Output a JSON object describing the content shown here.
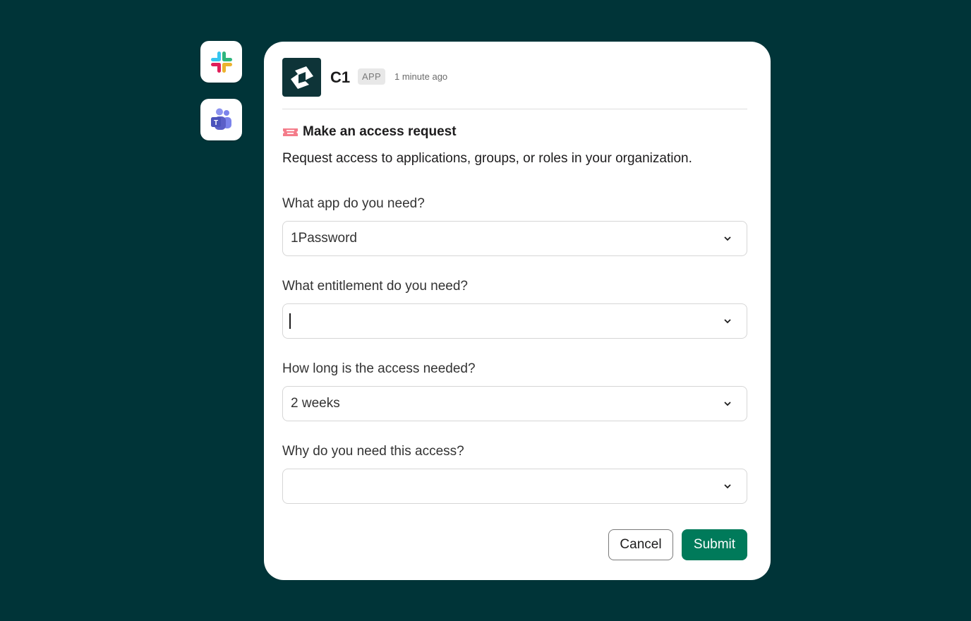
{
  "integrations": [
    {
      "name": "slack",
      "icon": "slack-icon"
    },
    {
      "name": "teams",
      "icon": "teams-icon"
    }
  ],
  "message": {
    "app_name": "C1",
    "badge": "APP",
    "timestamp": "1 minute ago",
    "title": "Make an access request",
    "title_icon": "ticket-icon",
    "description": "Request access to applications, groups, or roles in your organization."
  },
  "form": {
    "app": {
      "label": " What app do you need?",
      "value": "1Password"
    },
    "entitlement": {
      "label": "What entitlement do you need?",
      "value": ""
    },
    "duration": {
      "label": "How long is the access needed?",
      "value": "2 weeks"
    },
    "reason": {
      "label": "Why do you need this access?",
      "value": ""
    }
  },
  "actions": {
    "cancel_label": "Cancel",
    "submit_label": "Submit"
  },
  "colors": {
    "background": "#003438",
    "logo_bg": "#0e3438",
    "submit": "#007a5a"
  }
}
